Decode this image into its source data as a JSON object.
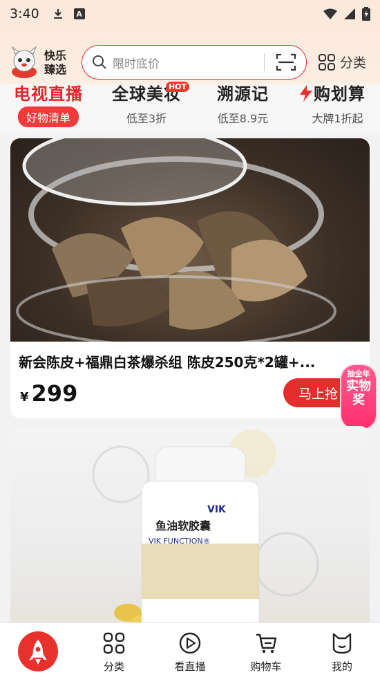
{
  "status_bar": {
    "time": "3:40"
  },
  "header": {
    "logo_text": "快乐臻选",
    "search_placeholder": "限时底价",
    "category_label": "分类"
  },
  "channels": [
    {
      "title": "电视直播",
      "sub": "好物清单",
      "title_color": "#e02828"
    },
    {
      "title": "全球美妆",
      "sub": "低至3折",
      "badge": "HOT",
      "title_color": "#222222"
    },
    {
      "title": "溯源记",
      "sub": "低至8.9元",
      "title_color": "#222222"
    },
    {
      "title": "购划算",
      "sub": "大牌1折起",
      "title_color": "#222222"
    }
  ],
  "products": [
    {
      "title": "新会陈皮+福鼎白茶爆杀组 陈皮250克*2罐+...",
      "currency": "¥",
      "price": "299",
      "buy_label": "马上抢"
    },
    {
      "title": "",
      "package_brand": "VIK",
      "package_name": "鱼油软胶囊",
      "package_sub": "VIK FUNCTION®"
    }
  ],
  "prize_badge": {
    "top": "抽全年",
    "main": "实物奖"
  },
  "bottom_nav": [
    {
      "label": "",
      "icon": "rocket-icon"
    },
    {
      "label": "分类",
      "icon": "grid-icon"
    },
    {
      "label": "看直播",
      "icon": "play-icon"
    },
    {
      "label": "购物车",
      "icon": "cart-icon"
    },
    {
      "label": "我的",
      "icon": "cat-face-icon"
    }
  ],
  "colors": {
    "accent": "#e62d2d",
    "header_bg": "#fbe9dc"
  }
}
